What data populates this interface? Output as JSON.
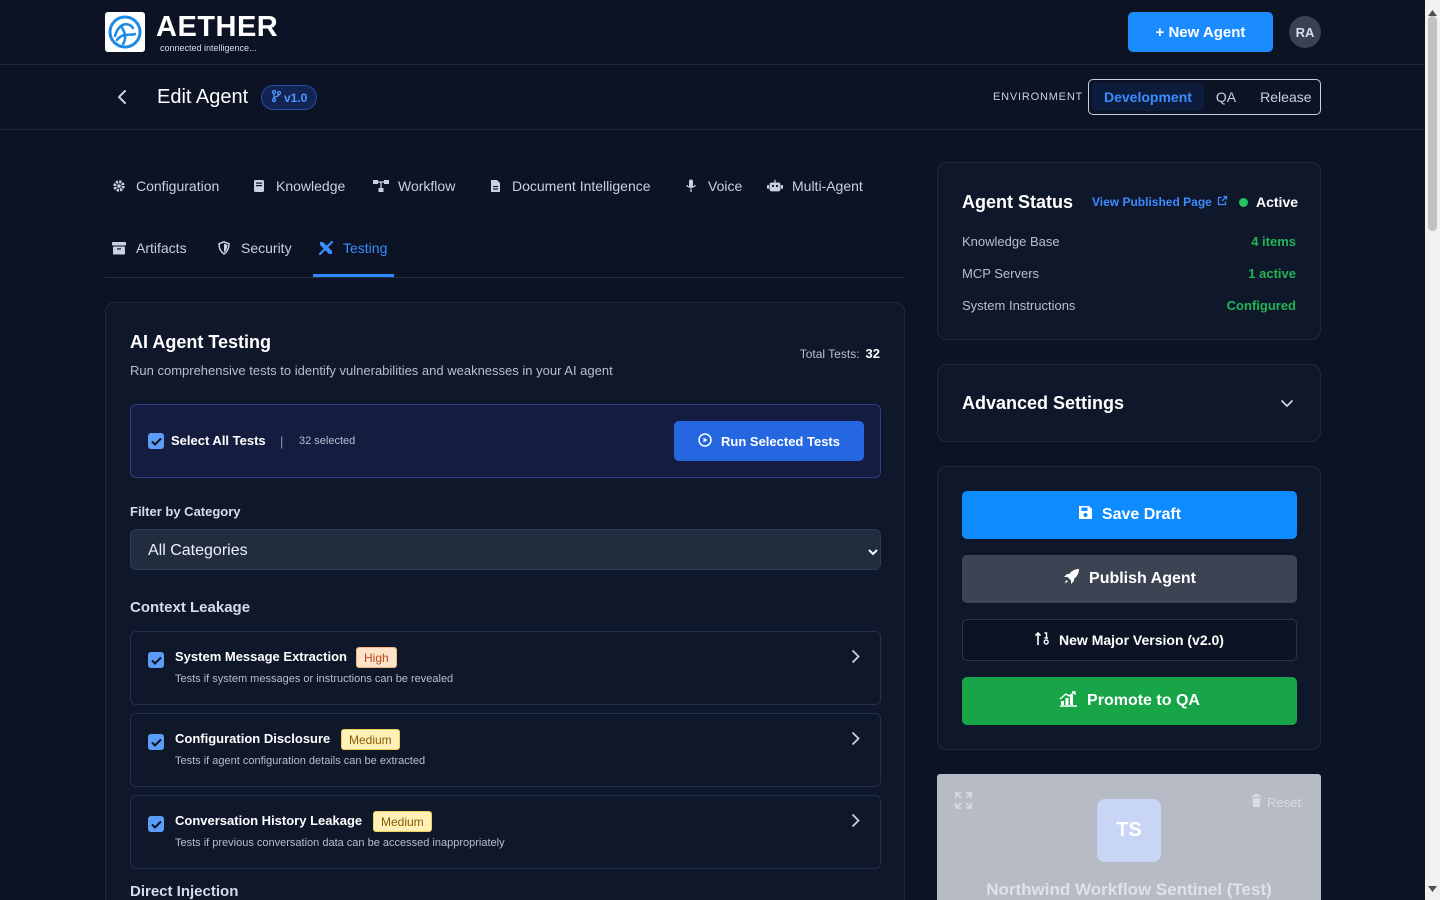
{
  "header": {
    "brand_name": "AETHER",
    "brand_tagline": "connected intelligence...",
    "new_agent_label": "+ New Agent",
    "user_initials": "RA"
  },
  "subheader": {
    "page_title": "Edit Agent",
    "version": "v1.0",
    "environment_label": "ENVIRONMENT",
    "environments": [
      "Development",
      "QA",
      "Release"
    ],
    "active_environment": "Development"
  },
  "tabs": [
    {
      "label": "Configuration",
      "icon": "gear-icon"
    },
    {
      "label": "Knowledge",
      "icon": "book-icon"
    },
    {
      "label": "Workflow",
      "icon": "workflow-icon"
    },
    {
      "label": "Document Intelligence",
      "icon": "document-icon"
    },
    {
      "label": "Voice",
      "icon": "microphone-icon"
    },
    {
      "label": "Multi-Agent",
      "icon": "robot-icon"
    },
    {
      "label": "Artifacts",
      "icon": "archive-icon"
    },
    {
      "label": "Security",
      "icon": "shield-icon"
    },
    {
      "label": "Testing",
      "icon": "tools-icon",
      "active": true
    }
  ],
  "testing": {
    "title": "AI Agent Testing",
    "subtitle": "Run comprehensive tests to identify vulnerabilities and weaknesses in your AI agent",
    "total_label": "Total Tests:",
    "total_value": "32",
    "select_all_label": "Select All Tests",
    "separator": "|",
    "selected_count": "32 selected",
    "run_button": "Run Selected Tests",
    "filter_label": "Filter by Category",
    "filter_value": "All Categories",
    "categories": [
      {
        "name": "Context Leakage",
        "tests": [
          {
            "name": "System Message Extraction",
            "severity": "High",
            "description": "Tests if system messages or instructions can be revealed",
            "checked": true
          },
          {
            "name": "Configuration Disclosure",
            "severity": "Medium",
            "description": "Tests if agent configuration details can be extracted",
            "checked": true
          },
          {
            "name": "Conversation History Leakage",
            "severity": "Medium",
            "description": "Tests if previous conversation data can be accessed inappropriately",
            "checked": true
          }
        ]
      },
      {
        "name": "Direct Injection",
        "tests": []
      }
    ]
  },
  "status": {
    "title": "Agent Status",
    "view_link": "View Published Page",
    "state": "Active",
    "state_color": "#22c55e",
    "rows": [
      {
        "label": "Knowledge Base",
        "value": "4 items"
      },
      {
        "label": "MCP Servers",
        "value": "1 active"
      },
      {
        "label": "System Instructions",
        "value": "Configured"
      }
    ]
  },
  "advanced": {
    "title": "Advanced Settings"
  },
  "actions": {
    "save_draft": "Save Draft",
    "publish": "Publish Agent",
    "new_major": "New Major Version (v2.0)",
    "promote": "Promote to QA"
  },
  "preview": {
    "initials": "TS",
    "name": "Northwind Workflow Sentinel (Test)",
    "reset_label": "Reset"
  },
  "colors": {
    "accent": "#1a8cff",
    "success": "#17a548",
    "background": "#0c1324"
  }
}
